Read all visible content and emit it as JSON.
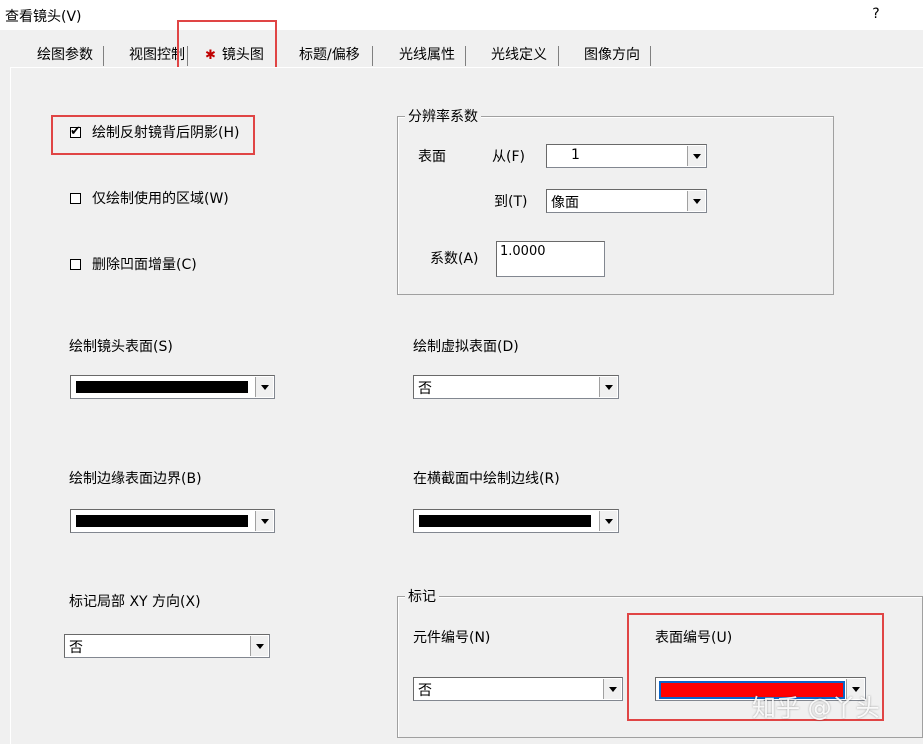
{
  "window": {
    "title": "查看镜头(V)",
    "help_label": "?"
  },
  "tabs": [
    {
      "label": "绘图参数",
      "active": false
    },
    {
      "label": "视图控制",
      "active": false
    },
    {
      "label": "镜头图",
      "active": true
    },
    {
      "label": "标题/偏移",
      "active": false
    },
    {
      "label": "光线属性",
      "active": false
    },
    {
      "label": "光线定义",
      "active": false
    },
    {
      "label": "图像方向",
      "active": false
    }
  ],
  "checkboxes": {
    "mirror_shadow": {
      "label": "绘制反射镜背后阴影(H)",
      "checked": true
    },
    "used_region": {
      "label": "仅绘制使用的区域(W)",
      "checked": false
    },
    "delete_concave": {
      "label": "删除凹面增量(C)",
      "checked": false
    }
  },
  "resolution": {
    "title": "分辨率系数",
    "surface_label": "表面",
    "from_label": "从(F)",
    "from_value": "1",
    "to_label": "到(T)",
    "to_value": "像面",
    "factor_label": "系数(A)",
    "factor_value": "1.0000"
  },
  "draw_lens_surface": {
    "label": "绘制镜头表面(S)",
    "color": "#000000"
  },
  "draw_virtual_surface": {
    "label": "绘制虚拟表面(D)",
    "value": "否"
  },
  "draw_edge_boundary": {
    "label": "绘制边缘表面边界(B)",
    "color": "#000000"
  },
  "draw_cross_edge": {
    "label": "在横截面中绘制边线(R)",
    "color": "#000000"
  },
  "mark_local_xy": {
    "label": "标记局部 XY 方向(X)",
    "value": "否"
  },
  "marks": {
    "title": "标记",
    "element_label": "元件编号(N)",
    "element_value": "否",
    "surface_label": "表面编号(U)",
    "surface_color": "#ff0000",
    "surface_border": "#0a64c8"
  },
  "highlight_color": "#e04545",
  "watermark": "知乎 @丫头"
}
